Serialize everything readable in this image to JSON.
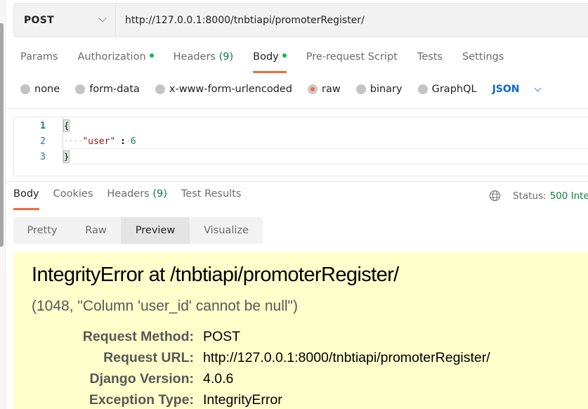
{
  "request": {
    "method": "POST",
    "url": "http://127.0.0.1:8000/tnbtiapi/promoterRegister/"
  },
  "request_tabs": [
    {
      "label": "Params",
      "active": false,
      "dot": false
    },
    {
      "label": "Authorization",
      "active": false,
      "dot": true
    },
    {
      "label": "Headers",
      "count": "(9)",
      "active": false,
      "dot": false
    },
    {
      "label": "Body",
      "active": true,
      "dot": true
    },
    {
      "label": "Pre-request Script",
      "active": false,
      "dot": false
    },
    {
      "label": "Tests",
      "active": false,
      "dot": false
    },
    {
      "label": "Settings",
      "active": false,
      "dot": false
    }
  ],
  "body_types": [
    {
      "label": "none",
      "selected": false
    },
    {
      "label": "form-data",
      "selected": false
    },
    {
      "label": "x-www-form-urlencoded",
      "selected": false
    },
    {
      "label": "raw",
      "selected": true
    },
    {
      "label": "binary",
      "selected": false
    },
    {
      "label": "GraphQL",
      "selected": false
    }
  ],
  "body_language": "JSON",
  "editor": {
    "lines": [
      {
        "number": "1",
        "text": "{"
      },
      {
        "number": "2",
        "key": "\"user\"",
        "colon": ":",
        "value": "6"
      },
      {
        "number": "3",
        "text": "}"
      }
    ]
  },
  "response_tabs": [
    {
      "label": "Body",
      "active": true
    },
    {
      "label": "Cookies",
      "active": false
    },
    {
      "label": "Headers",
      "count": "(9)",
      "active": false
    },
    {
      "label": "Test Results",
      "active": false
    }
  ],
  "status": {
    "label": "Status:",
    "value": "500 Inte"
  },
  "view_modes": [
    {
      "label": "Pretty",
      "active": false
    },
    {
      "label": "Raw",
      "active": false
    },
    {
      "label": "Preview",
      "active": true
    },
    {
      "label": "Visualize",
      "active": false
    }
  ],
  "preview": {
    "title": "IntegrityError at /tnbtiapi/promoterRegister/",
    "subtitle": "(1048, \"Column 'user_id' cannot be null\")",
    "meta": [
      {
        "key": "Request Method:",
        "value": "POST"
      },
      {
        "key": "Request URL:",
        "value": "http://127.0.0.1:8000/tnbtiapi/promoterRegister/"
      },
      {
        "key": "Django Version:",
        "value": "4.0.6"
      },
      {
        "key": "Exception Type:",
        "value": "IntegrityError"
      }
    ]
  },
  "colors": {
    "accent": "#f26b3a",
    "success_dot": "#0cbb52",
    "count_green": "#0a7e3a",
    "link_blue": "#0b66d6",
    "preview_bg": "#ffffcc"
  }
}
